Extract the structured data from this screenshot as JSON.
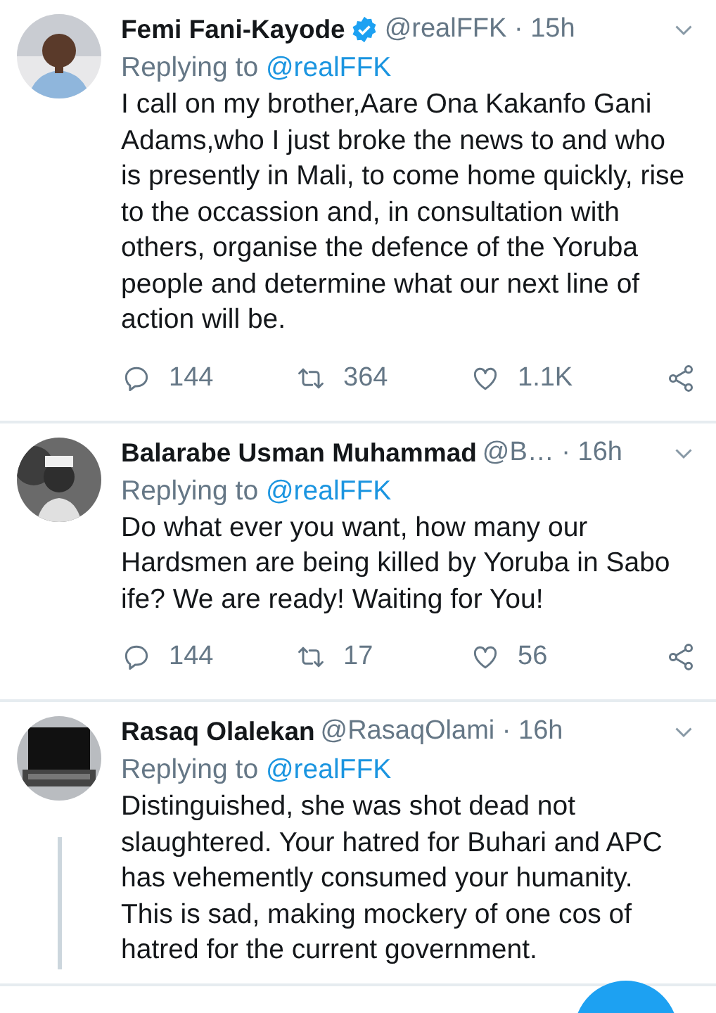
{
  "tweets": [
    {
      "name": "Femi Fani-Kayode",
      "verified": true,
      "meta": "@realFFK · 15h",
      "replying_label": "Replying to",
      "reply_handle": "@realFFK",
      "text": "I call on my brother,Aare Ona Kakanfo Gani\nAdams,who I just broke the news to and who\nis presently in Mali, to come home quickly, rise\nto the occassion and, in consultation with\nothers, organise the defence of the Yoruba\npeople and determine what our next line of\naction will be.",
      "thread_line": false,
      "actions": [
        {
          "kind": "reply",
          "count": "144"
        },
        {
          "kind": "retweet",
          "count": "364"
        },
        {
          "kind": "like",
          "count": "1.1K"
        },
        {
          "kind": "share"
        }
      ]
    },
    {
      "name": "Balarabe Usman Muhammad",
      "verified": false,
      "meta": "@B…  · 16h",
      "replying_label": "Replying to",
      "reply_handle": "@realFFK",
      "text": "Do what ever you want, how many our\nHardsmen are being killed by Yoruba in Sabo\nife? We are ready! Waiting for You!",
      "thread_line": false,
      "actions": [
        {
          "kind": "reply",
          "count": "144"
        },
        {
          "kind": "retweet",
          "count": "17"
        },
        {
          "kind": "like",
          "count": "56"
        },
        {
          "kind": "share"
        }
      ]
    },
    {
      "name": "Rasaq Olalekan",
      "verified": false,
      "meta": "@RasaqOlami · 16h",
      "replying_label": "Replying to",
      "reply_handle": "@realFFK",
      "text": "Distinguished, she was shot dead not\nslaughtered. Your hatred for Buhari and APC\nhas vehemently consumed your humanity.\nThis is sad, making mockery of one cos of\nhatred for the current government.",
      "thread_line": true
    }
  ],
  "compose_button": {
    "visible": true
  }
}
